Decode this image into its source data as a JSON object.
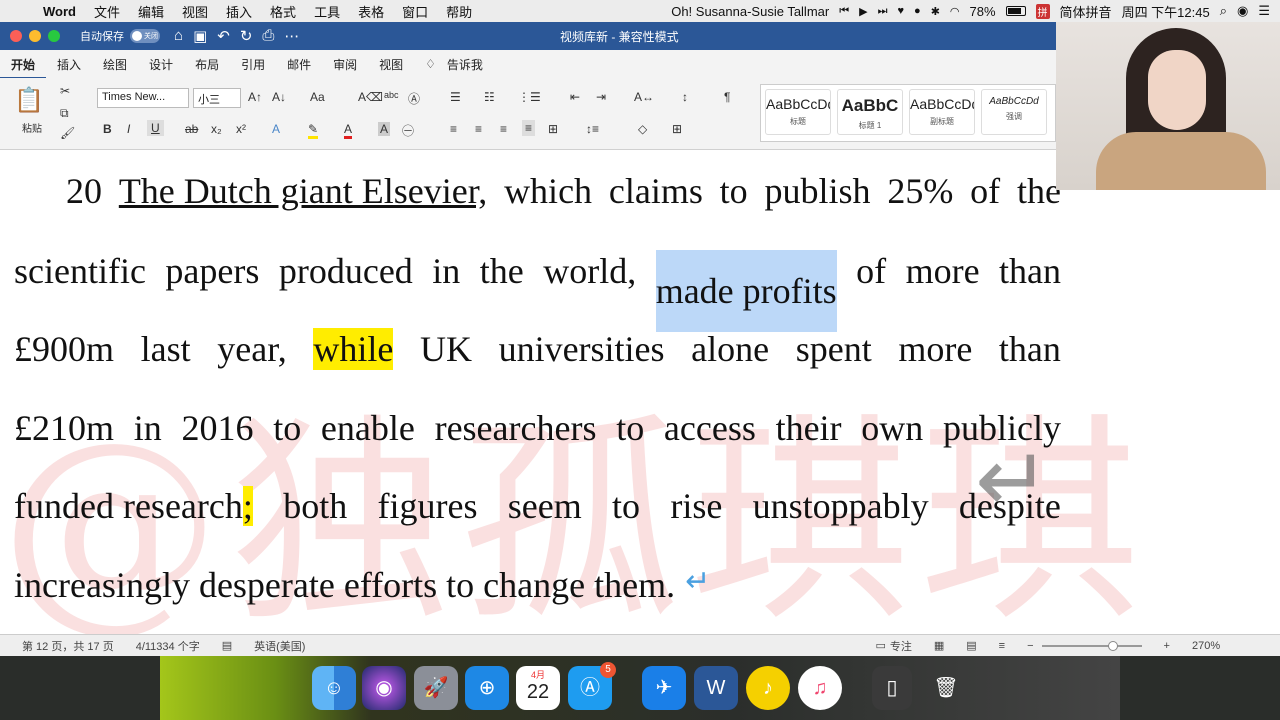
{
  "menubar": {
    "apple": "",
    "items": [
      "Word",
      "文件",
      "编辑",
      "视图",
      "插入",
      "格式",
      "工具",
      "表格",
      "窗口",
      "帮助"
    ],
    "now_playing": "Oh! Susanna-Susie Tallmar",
    "battery": "78%",
    "input_method": "简体拼音",
    "clock": "周四 下午12:45"
  },
  "titlebar": {
    "autosave_label": "自动保存",
    "autosave_state": "关闭",
    "doc_title": "视频库新 - 兼容性模式"
  },
  "ribbon": {
    "tabs": [
      "开始",
      "插入",
      "绘图",
      "设计",
      "布局",
      "引用",
      "邮件",
      "审阅",
      "视图"
    ],
    "tell_me": "告诉我",
    "paste_label": "粘贴",
    "font_name": "Times New...",
    "font_size": "小三",
    "styles": [
      {
        "sample": "AaBbCcDd",
        "name": "标题"
      },
      {
        "sample": "AaBbC",
        "name": "标题 1"
      },
      {
        "sample": "AaBbCcDd",
        "name": "副标题"
      },
      {
        "sample": "AaBbCcDd",
        "name": "强调"
      }
    ]
  },
  "document": {
    "watermark": "@独孤琪琪",
    "line1": {
      "num": "20",
      "underlined": "The Dutch giant Elsevier,",
      "words": [
        "which",
        "claims",
        "to",
        "publish",
        "25%",
        "of",
        "the"
      ]
    },
    "line2": {
      "before": [
        "scientific",
        "papers",
        "produced",
        "in",
        "the",
        "world,"
      ],
      "selected": "made profits",
      "after": [
        "of",
        "more",
        "than"
      ]
    },
    "line3": {
      "before": [
        "£900m",
        "last",
        "year,"
      ],
      "highlighted": "while",
      "after": [
        "UK",
        "universities",
        "alone",
        "spent",
        "more",
        "than"
      ]
    },
    "line4": {
      "words": [
        "£210m",
        "in",
        "2016",
        "to",
        "enable",
        "researchers",
        "to",
        "access",
        "their",
        "own",
        "publicly"
      ]
    },
    "line5": {
      "before": "funded research",
      "highlighted": ";",
      "words": [
        "both",
        "figures",
        "seem",
        "to",
        "rise",
        "unstoppably",
        "despite"
      ]
    },
    "line6": {
      "text": "increasingly desperate efforts to change them."
    }
  },
  "statusbar": {
    "page": "第 12 页，共 17 页",
    "words": "4/11334 个字",
    "language": "英语(美国)",
    "focus": "专注",
    "zoom": "270%"
  },
  "dock": {
    "calendar_month": "4月",
    "calendar_day": "22",
    "appstore_badge": "5"
  }
}
